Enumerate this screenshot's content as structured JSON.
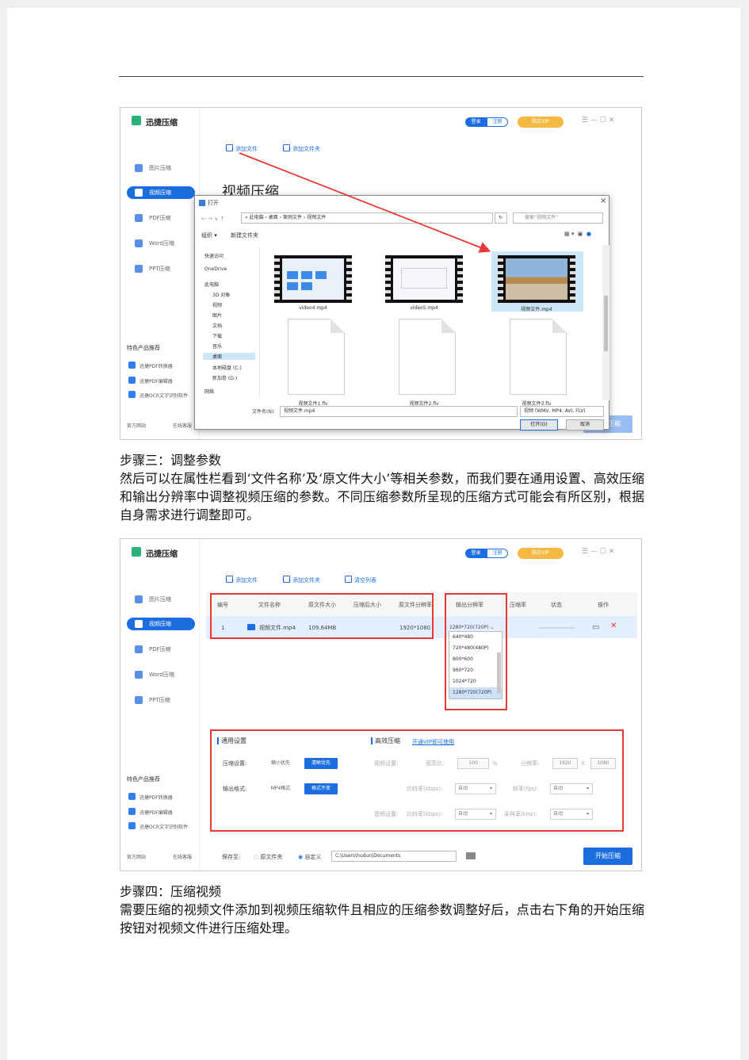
{
  "app": {
    "title": "迅捷压缩",
    "login": "登录",
    "register": "注册",
    "vip": "购买VIP",
    "win_controls": "☰ — ☐ ✕"
  },
  "sidebar": {
    "items": [
      "图片压缩",
      "视频压缩",
      "PDF压缩",
      "Word压缩",
      "PPT压缩"
    ],
    "section": "特色产品推荐",
    "products": [
      "迅捷PDF转换器",
      "迅捷PDF编辑器",
      "迅捷OCR文字识别软件"
    ],
    "footer_left": "官方网站",
    "footer_right": "在线客服"
  },
  "shot1": {
    "toolbar": [
      "添加文件",
      "添加文件夹"
    ],
    "heading": "视频压缩",
    "dialog": {
      "title": "打开",
      "close": "×",
      "nav": "← → ∨ ↑",
      "path": "« 此电脑 › 桌面 › 案例文件 › 视频文件",
      "refresh": "↻",
      "search": "搜索“视频文件”",
      "organize": "组织 ▾",
      "new_folder": "新建文件夹",
      "tree": [
        "快速访问",
        "OneDrive",
        "此电脑",
        "3D 对象",
        "视频",
        "图片",
        "文档",
        "下载",
        "音乐",
        "桌面",
        "本地磁盘 (C:)",
        "新加卷 (D:)",
        "网络"
      ],
      "files": [
        "video4.mp4",
        "video5.mp4",
        "视频文件.mp4",
        "视频文件1.flv",
        "视频文件2.flv",
        "视频文件3.flv"
      ],
      "filename_label": "文件名(N):",
      "filename_value": "视频文件.mp4",
      "filter": "视频 (WMV, MP4, AVI, FLV)",
      "open_btn": "打开(O)",
      "cancel_btn": "取消"
    },
    "bottom_btn": "开始压缩"
  },
  "text1": {
    "heading": "步骤三：调整参数",
    "body": "然后可以在属性栏看到‘文件名称’及‘原文件大小’等相关参数，而我们要在通用设置、高效压缩和输出分辨率中调整视频压缩的参数。不同压缩参数所呈现的压缩方式可能会有所区别，根据自身需求进行调整即可。"
  },
  "shot2": {
    "toolbar": [
      "添加文件",
      "添加文件夹",
      "清空列表"
    ],
    "columns": [
      "编号",
      "文件名称",
      "原文件大小",
      "压缩后大小",
      "原文件分辨率",
      "输出分辨率",
      "压缩率",
      "状态",
      "操作"
    ],
    "row": {
      "num": "1",
      "name": "视频文件.mp4",
      "size": "109.64MB",
      "after": "",
      "res": "1920*1080",
      "out": "1280*720(720P)  ⌄"
    },
    "dropdown": [
      "640*480",
      "720*480(480P)",
      "800*600",
      "960*720",
      "1024*720",
      "1280*720(720P)"
    ],
    "dropdown_selected": 5,
    "general": {
      "title": "通用设置",
      "mode_label": "压缩设置:",
      "mode_a": "缩小优先",
      "mode_b": "清晰优先",
      "fmt_label": "输出格式:",
      "fmt_a": "MP4格式",
      "fmt_b": "格式不变"
    },
    "efficient": {
      "title": "高效压缩",
      "vip_link": "开通VIP即可使用",
      "video_label": "视频设置:",
      "ratio_label": "宽高比:",
      "ratio_val": "100",
      "ratio_unit": "%",
      "res_label": "分辨率:",
      "res_w": "1920",
      "res_x": "X",
      "res_h": "1080",
      "bitrate_label": "比特率(kbps):",
      "auto": "自动",
      "fps_label": "帧率(fps):",
      "audio_label": "音频设置:",
      "abitrate_label": "比特率(kbps):",
      "sample_label": "采样率(kHz):"
    },
    "save": {
      "label": "保存至:",
      "orig": "原文件夹",
      "custom": "自定义",
      "path": "C:\\Users\\hudun\\Documents"
    },
    "start_btn": "开始压缩"
  },
  "text2": {
    "heading": "步骤四：压缩视频",
    "body": "需要压缩的视频文件添加到视频压缩软件且相应的压缩参数调整好后，点击右下角的开始压缩按钮对视频文件进行压缩处理。"
  },
  "colors": {
    "accent": "#1c6ee0",
    "red": "#e53935",
    "vip": "#f4b942"
  }
}
